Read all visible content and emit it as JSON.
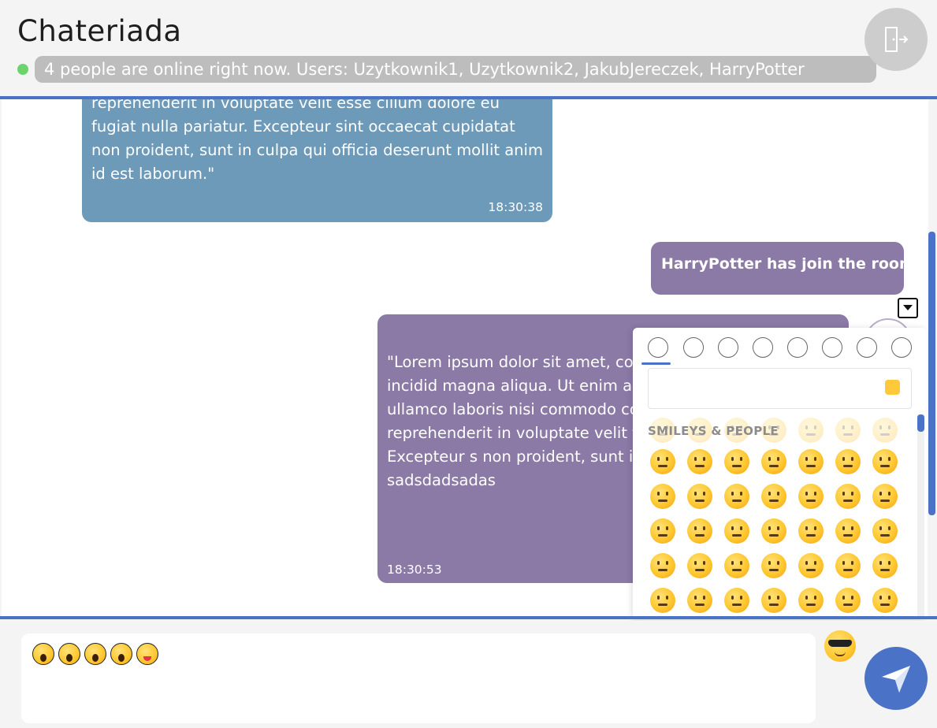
{
  "app": {
    "title": "Chateriada"
  },
  "header": {
    "online_text": "4 people are online right now. Users: Uzytkownik1, Uzytkownik2, JakubJereczek, HarryPotter",
    "exit_icon": "exit-door-icon"
  },
  "messages": [
    {
      "text": "commodo consequat. Duis aute irure dolor in reprehenderit in voluptate velit esse cillum dolore eu fugiat nulla pariatur. Excepteur sint occaecat cupidatat non proident, sunt in culpa qui officia deserunt mollit anim id est laborum.\"",
      "time": "18:30:38"
    },
    {
      "text": "HarryPotter has join the room"
    },
    {
      "text": "\"Lorem ipsum dolor sit amet, co sed do eiusmod tempor incidid magna aliqua. Ut enim ad minir exercitation ullamco laboris nisi commodo consequat. Duis aute reprehenderit in voluptate velit fugiat nulla pariatur. Excepteur s non proident, sunt in culpa qui c sadsdadsadas",
      "time": "18:30:53"
    }
  ],
  "emoji_picker": {
    "categories": [
      "smileys-people",
      "animals-nature",
      "food-drink",
      "travel-places",
      "activities",
      "objects",
      "symbols",
      "flags"
    ],
    "active_category": "smileys-people",
    "section_label": "SMILEYS & PEOPLE",
    "skin_tone_color": "#ffc93a",
    "rows": 6,
    "cols": 7
  },
  "composer": {
    "emojis": [
      "astonished",
      "astonished",
      "astonished",
      "astonished",
      "squinting-tongue"
    ],
    "emoji_toggle_icon": "sunglasses-face-icon",
    "send_icon": "paper-plane-icon"
  },
  "colors": {
    "accent": "#4a72c6",
    "bubble_blue": "#6d9ab9",
    "bubble_purple": "#8b79a6",
    "online": "#6cd46c"
  }
}
